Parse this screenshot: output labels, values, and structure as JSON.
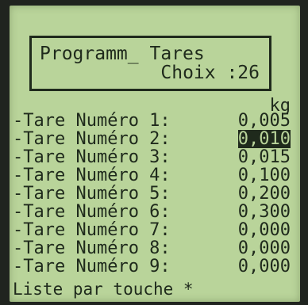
{
  "screen": {
    "title": "Programm_ Tares",
    "choice": "Choix :26",
    "unit": "kg",
    "tares": [
      {
        "label": "-Tare Numéro 1:",
        "value": "0,005",
        "selected": false
      },
      {
        "label": "-Tare Numéro 2:",
        "value": "0,010",
        "selected": true
      },
      {
        "label": "-Tare Numéro 3:",
        "value": "0,015",
        "selected": false
      },
      {
        "label": "-Tare Numéro 4:",
        "value": "0,100",
        "selected": false
      },
      {
        "label": "-Tare Numéro 5:",
        "value": "0,200",
        "selected": false
      },
      {
        "label": "-Tare Numéro 6:",
        "value": "0,300",
        "selected": false
      },
      {
        "label": "-Tare Numéro 7:",
        "value": "0,000",
        "selected": false
      },
      {
        "label": "-Tare Numéro 8:",
        "value": "0,000",
        "selected": false
      },
      {
        "label": "-Tare Numéro 9:",
        "value": "0,000",
        "selected": false
      }
    ],
    "footer": "Liste par touche *"
  },
  "colors": {
    "lcd_background": "#b9d49a",
    "lcd_text": "#1f2a1c",
    "bezel": "#20241f"
  }
}
